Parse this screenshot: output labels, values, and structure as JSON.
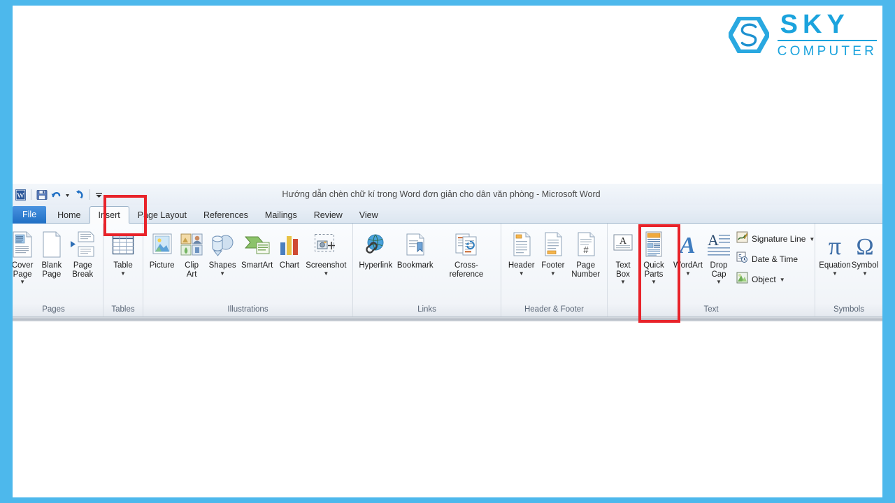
{
  "theme": {
    "frame_color": "#4db8ec",
    "accent_red": "#e8232a",
    "logo_blue": "#1ba3dd"
  },
  "logo": {
    "name": "sky-computer-logo",
    "primary": "SKY",
    "secondary": "COMPUTER"
  },
  "window": {
    "title": "Hướng dẫn chèn chữ kí trong Word đơn giản cho dân văn phòng  -  Microsoft Word",
    "app_icon": "word-icon"
  },
  "quick_access_toolbar": {
    "items": [
      {
        "name": "save-icon",
        "label": "Save"
      },
      {
        "name": "undo-icon",
        "label": "Undo"
      },
      {
        "name": "undo-dropdown-icon",
        "label": "Undo options"
      },
      {
        "name": "redo-icon",
        "label": "Redo"
      },
      {
        "name": "customize-qat-icon",
        "label": "Customize Quick Access Toolbar"
      }
    ]
  },
  "tabs": [
    {
      "label": "File",
      "state": "file"
    },
    {
      "label": "Home",
      "state": "normal"
    },
    {
      "label": "Insert",
      "state": "active"
    },
    {
      "label": "Page Layout",
      "state": "normal"
    },
    {
      "label": "References",
      "state": "normal"
    },
    {
      "label": "Mailings",
      "state": "normal"
    },
    {
      "label": "Review",
      "state": "normal"
    },
    {
      "label": "View",
      "state": "normal"
    }
  ],
  "ribbon": {
    "groups": [
      {
        "name": "Pages",
        "buttons": [
          {
            "label": "Cover\nPage",
            "icon": "cover-page-icon",
            "caret": "inline"
          },
          {
            "label": "Blank\nPage",
            "icon": "blank-page-icon",
            "caret": "none"
          },
          {
            "label": "Page\nBreak",
            "icon": "page-break-icon",
            "caret": "none"
          }
        ]
      },
      {
        "name": "Tables",
        "buttons": [
          {
            "label": "Table",
            "icon": "table-icon",
            "caret": "below"
          }
        ]
      },
      {
        "name": "Illustrations",
        "buttons": [
          {
            "label": "Picture",
            "icon": "picture-icon",
            "caret": "none"
          },
          {
            "label": "Clip\nArt",
            "icon": "clip-art-icon",
            "caret": "none"
          },
          {
            "label": "Shapes",
            "icon": "shapes-icon",
            "caret": "below"
          },
          {
            "label": "SmartArt",
            "icon": "smartart-icon",
            "caret": "none"
          },
          {
            "label": "Chart",
            "icon": "chart-icon",
            "caret": "none"
          },
          {
            "label": "Screenshot",
            "icon": "screenshot-icon",
            "caret": "below"
          }
        ]
      },
      {
        "name": "Links",
        "buttons": [
          {
            "label": "Hyperlink",
            "icon": "hyperlink-icon",
            "caret": "none"
          },
          {
            "label": "Bookmark",
            "icon": "bookmark-icon",
            "caret": "none"
          },
          {
            "label": "Cross-reference",
            "icon": "cross-reference-icon",
            "caret": "none"
          }
        ]
      },
      {
        "name": "Header & Footer",
        "buttons": [
          {
            "label": "Header",
            "icon": "header-icon",
            "caret": "below"
          },
          {
            "label": "Footer",
            "icon": "footer-icon",
            "caret": "below"
          },
          {
            "label": "Page\nNumber",
            "icon": "page-number-icon",
            "caret": "inline"
          }
        ]
      },
      {
        "name": "Text",
        "buttons": [
          {
            "label": "Text\nBox",
            "icon": "text-box-icon",
            "caret": "inline"
          },
          {
            "label": "Quick\nParts",
            "icon": "quick-parts-icon",
            "caret": "inline",
            "highlighted": true
          },
          {
            "label": "WordArt",
            "icon": "wordart-icon",
            "caret": "below"
          },
          {
            "label": "Drop\nCap",
            "icon": "drop-cap-icon",
            "caret": "inline"
          }
        ],
        "small_buttons": [
          {
            "label": "Signature Line",
            "icon": "signature-line-icon",
            "caret": true
          },
          {
            "label": "Date & Time",
            "icon": "date-time-icon",
            "caret": false
          },
          {
            "label": "Object",
            "icon": "object-icon",
            "caret": true
          }
        ]
      },
      {
        "name": "Symbols",
        "buttons": [
          {
            "label": "Equation",
            "icon": "equation-icon",
            "caret": "below"
          },
          {
            "label": "Symbol",
            "icon": "symbol-icon",
            "caret": "below"
          }
        ]
      }
    ]
  },
  "highlights": [
    {
      "name": "insert-tab-highlight",
      "target": "Insert"
    },
    {
      "name": "quick-parts-highlight",
      "target": "Quick Parts"
    }
  ]
}
